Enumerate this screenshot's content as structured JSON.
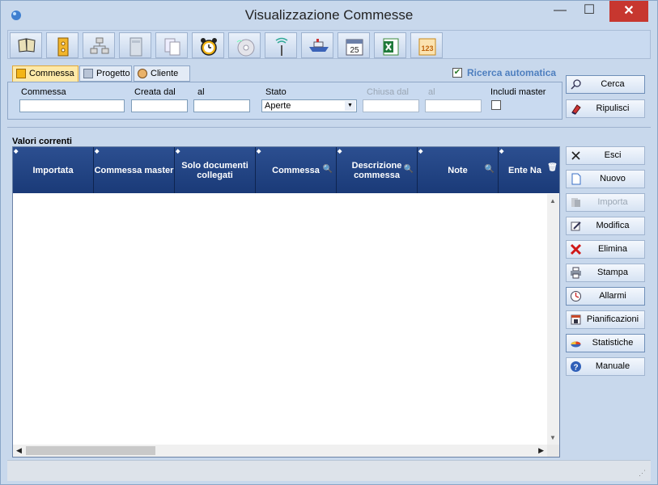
{
  "window": {
    "title": "Visualizzazione Commesse",
    "minimize": "—",
    "maximize": "☐",
    "close": "✕"
  },
  "toolbar": {
    "icons": [
      "book-icon",
      "binder-icon",
      "network-icon",
      "archive-icon",
      "documents-icon",
      "alarm-clock-icon",
      "disc-icon",
      "antenna-icon",
      "ship-icon",
      "calendar-icon",
      "excel-icon",
      "counter-icon"
    ],
    "calendar_day": "25",
    "counter_label": "123"
  },
  "search": {
    "tabs": [
      {
        "label": "Commessa",
        "active": true
      },
      {
        "label": "Progetto",
        "active": false
      },
      {
        "label": "Cliente",
        "active": false
      }
    ],
    "ricerca_automatica_label": "Ricerca automatica",
    "ricerca_automatica_checked": true,
    "fields": {
      "commessa_label": "Commessa",
      "creata_dal_label": "Creata dal",
      "al_label": "al",
      "stato_label": "Stato",
      "stato_value": "Aperte",
      "chiusa_dal_label": "Chiusa dal",
      "al2_label": "al",
      "includi_master_label": "Includi master"
    }
  },
  "right_buttons": {
    "cerca": "Cerca",
    "ripulisci": "Ripulisci",
    "esci": "Esci",
    "nuovo": "Nuovo",
    "importa": "Importa",
    "modifica": "Modifica",
    "elimina": "Elimina",
    "stampa": "Stampa",
    "allarmi": "Allarmi",
    "pianificazioni": "Pianificazioni",
    "statistiche": "Statistiche",
    "manuale": "Manuale"
  },
  "grid": {
    "section_label": "Valori correnti",
    "columns": [
      "Importata",
      "Commessa master",
      "Solo documenti collegati",
      "Commessa",
      "Descrizione commessa",
      "Note",
      "Ente Na"
    ],
    "rows": []
  },
  "colors": {
    "accent": "#1a3a78",
    "window_bg": "#c8d8ec",
    "close_red": "#c7372f"
  }
}
